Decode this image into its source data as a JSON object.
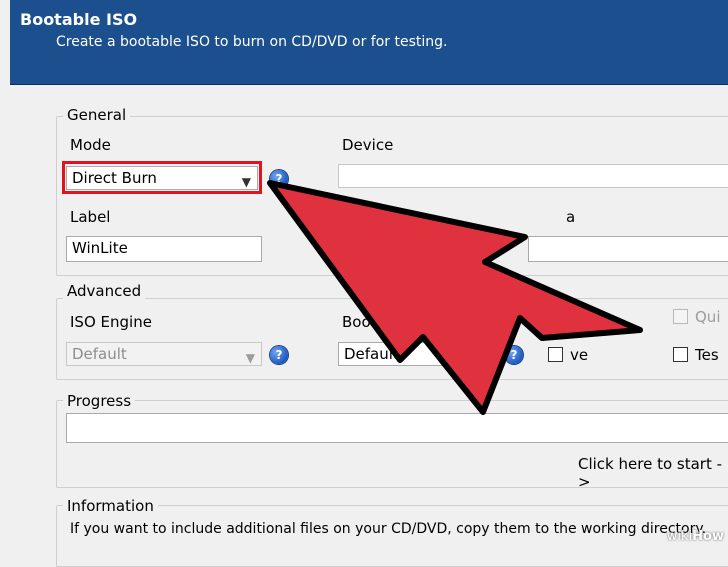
{
  "header": {
    "title": "Bootable ISO",
    "subtitle": "Create a bootable ISO to burn on CD/DVD or for testing."
  },
  "general": {
    "legend": "General",
    "mode_label": "Mode",
    "mode_value": "Direct Burn",
    "device_label": "Device",
    "label_label": "Label",
    "label_value": "WinLite",
    "media_label_partial": "a"
  },
  "advanced": {
    "legend": "Advanced",
    "iso_engine_label": "ISO Engine",
    "iso_engine_value": "Default",
    "boot_sector_label": "Boot se",
    "boot_sector_value": "Default",
    "check1_label": "ve",
    "check2_label": "Qui",
    "check3_label": "Tes"
  },
  "progress": {
    "legend": "Progress",
    "status_text": "Click here to start ->",
    "percent": 0
  },
  "information": {
    "legend": "Information",
    "text": "If you want to include additional files on your CD/DVD, copy them to the working directory."
  },
  "icons": {
    "help": "help-icon",
    "dropdown": "chevron-down-icon",
    "annotation": "arrow-annotation"
  },
  "colors": {
    "header_bg": "#1b4f8e",
    "arrow_fill": "#e0313e",
    "highlight": "#e0141e"
  },
  "watermark": {
    "prefix": "wiki",
    "suffix": "How"
  }
}
